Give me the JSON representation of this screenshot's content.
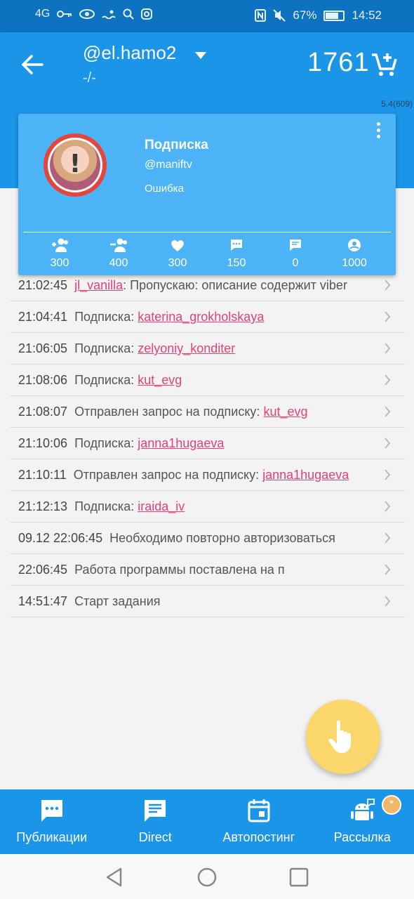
{
  "status_bar": {
    "network": "4G",
    "battery": "67%",
    "battery_level": 0.67,
    "time": "14:52"
  },
  "header": {
    "account": "@el.hamo2",
    "subtitle": "-/-",
    "balance": "1761",
    "version": "5.4(609)"
  },
  "task_card": {
    "title": "Подписка",
    "username": "@maniftv",
    "status": "Ошибка",
    "avatar_mark": "!",
    "stats": [
      {
        "icon": "follow-icon",
        "value": "300"
      },
      {
        "icon": "unfollow-icon",
        "value": "400"
      },
      {
        "icon": "heart-icon",
        "value": "300"
      },
      {
        "icon": "comment-icon",
        "value": "150"
      },
      {
        "icon": "message-icon",
        "value": "0"
      },
      {
        "icon": "profile-icon",
        "value": "1000"
      }
    ]
  },
  "log": [
    {
      "time": "21:02:45",
      "text": "",
      "user": "jl_vanilla",
      "after": ": Пропускаю: описание содержит viber"
    },
    {
      "time": "21:04:41",
      "text": "Подписка: ",
      "user": "katerina_grokholskaya",
      "after": ""
    },
    {
      "time": "21:06:05",
      "text": "Подписка: ",
      "user": "zelyoniy_konditer",
      "after": ""
    },
    {
      "time": "21:08:06",
      "text": "Подписка: ",
      "user": "kut_evg",
      "after": ""
    },
    {
      "time": "21:08:07",
      "text": "Отправлен запрос на подписку: ",
      "user": "kut_evg",
      "after": ""
    },
    {
      "time": "21:10:06",
      "text": "Подписка: ",
      "user": "janna1hugaeva",
      "after": ""
    },
    {
      "time": "21:10:11",
      "text": "Отправлен запрос на подписку: ",
      "user": "janna1hugaeva",
      "after": ""
    },
    {
      "time": "21:12:13",
      "text": "Подписка: ",
      "user": "iraida_iv",
      "after": ""
    },
    {
      "time": "09.12 22:06:45",
      "text": "Необходимо повторно авторизоваться",
      "user": "",
      "after": ""
    },
    {
      "time": "22:06:45",
      "text": "Работа программы поставлена на п",
      "user": "",
      "after": ""
    },
    {
      "time": "14:51:47",
      "text": "Старт задания",
      "user": "",
      "after": ""
    }
  ],
  "bottom_nav": [
    {
      "icon": "publications-icon",
      "label": "Публикации"
    },
    {
      "icon": "direct-icon",
      "label": "Direct"
    },
    {
      "icon": "calendar-icon",
      "label": "Автопостинг"
    },
    {
      "icon": "android-icon",
      "label": "Рассылка",
      "badge": "*"
    }
  ],
  "colors": {
    "status_bar": "#0d72c0",
    "primary": "#1a95e8",
    "card": "#4db3f7",
    "link": "#e4407a",
    "fab": "#fbd76b",
    "avatar_ring": "#e5453b"
  }
}
